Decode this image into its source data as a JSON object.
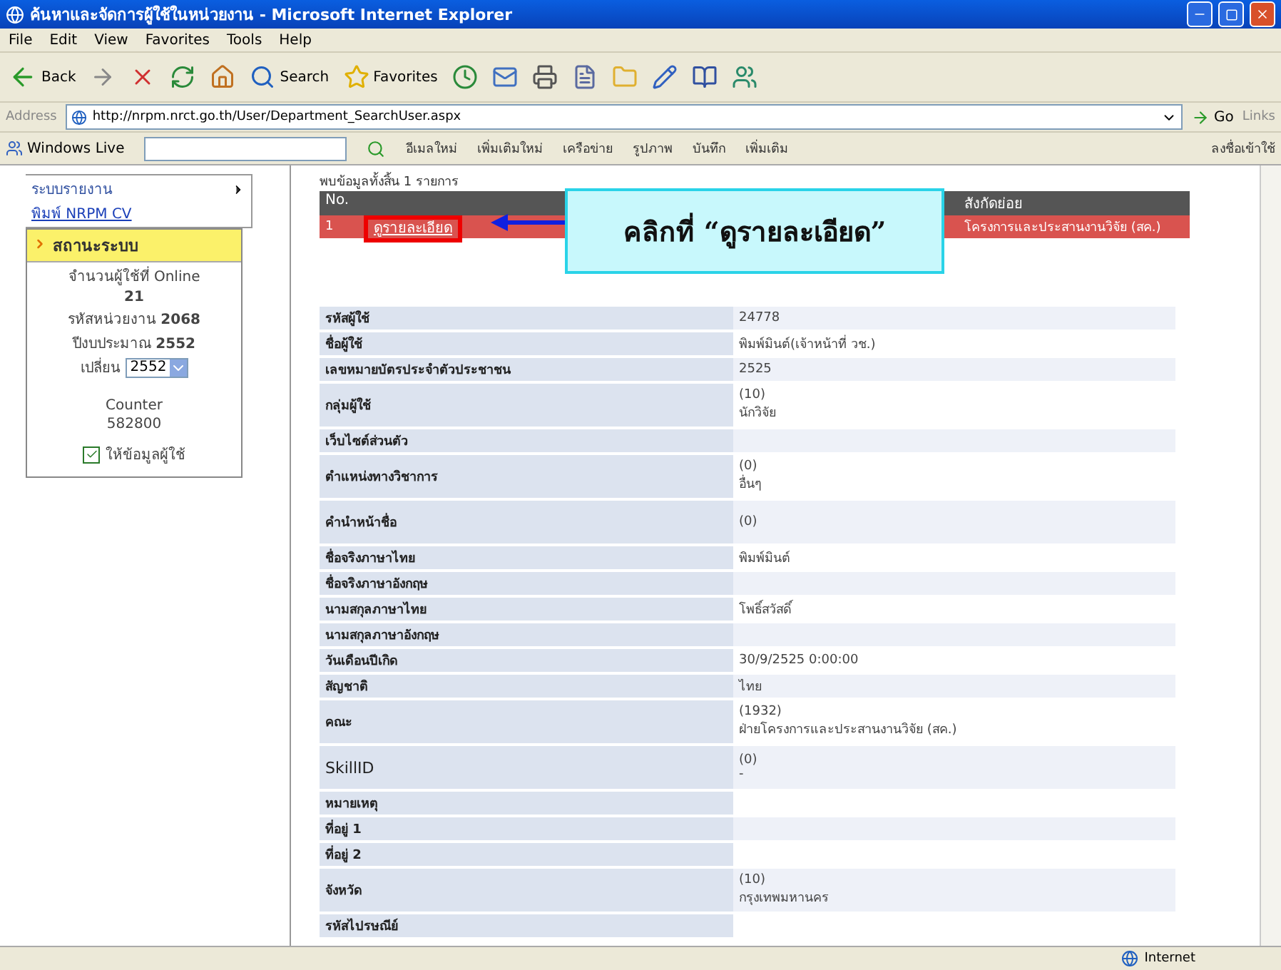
{
  "window": {
    "title": "ค้นหาและจัดการผู้ใช้ในหน่วยงาน - Microsoft Internet Explorer"
  },
  "menu": [
    "File",
    "Edit",
    "View",
    "Favorites",
    "Tools",
    "Help"
  ],
  "toolbar": [
    {
      "kind": "back",
      "label": "Back"
    },
    {
      "kind": "forward"
    },
    {
      "kind": "stop"
    },
    {
      "kind": "refresh"
    },
    {
      "kind": "home"
    },
    {
      "kind": "search",
      "label": "Search"
    },
    {
      "kind": "favorites",
      "label": "Favorites"
    },
    {
      "kind": "history"
    },
    {
      "kind": "mail"
    },
    {
      "kind": "print"
    },
    {
      "kind": "edit"
    },
    {
      "kind": "folder"
    },
    {
      "kind": "pen"
    },
    {
      "kind": "book"
    },
    {
      "kind": "people"
    }
  ],
  "address_bar": {
    "label": "Address",
    "value": "http://nrpm.nrct.go.th/User/Department_SearchUser.aspx",
    "go": "Go",
    "links": "Links"
  },
  "live_toolbar": {
    "brand": "Windows Live",
    "items": [
      "อีเมลใหม่",
      "เพิ่มเติมใหม่",
      "เครือข่าย",
      "รูปภาพ",
      "บันทึก",
      "เพิ่มเติม"
    ],
    "sign_in": "ลงชื่อเข้าใช้"
  },
  "sidebar": {
    "menu": [
      {
        "label": "ระบบรายงาน",
        "submenu": true,
        "link": false
      },
      {
        "label": "พิมพ์ NRPM CV",
        "submenu": false,
        "link": true
      }
    ],
    "status_panel": {
      "title": "สถานะระบบ",
      "lines": [
        "จำนวนผู้ใช้ที่ Online",
        "**21**",
        "รหัสหน่วยงาน **2068**",
        "ปีงบประมาณ **2552**"
      ],
      "year_label": "เปลี่ยน",
      "year": "2552",
      "counter_label": "Counter",
      "counter": "582800",
      "checkbox": {
        "label": "ให้ข้อมูลผู้ใช้",
        "checked": true
      }
    }
  },
  "results": {
    "summary": "พบข้อมูลทั้งสิ้น 1 รายการ",
    "header": {
      "no": "No.",
      "unit": "สังกัดย่อย"
    },
    "row": {
      "no": "1",
      "detail_link": "ดูรายละเอียด",
      "unit": "โครงการและประสานงานวิจัย (สค.)",
      "highlighted": true
    }
  },
  "callout": {
    "text": "คลิกที่ “ดูรายละเอียด”"
  },
  "details": [
    {
      "label": "รหัสผู้ใช้",
      "value": [
        "24778"
      ]
    },
    {
      "label": "ชื่อผู้ใช้",
      "value": [
        "พิมพ์มินต์(เจ้าหน้าที่ วช.)"
      ]
    },
    {
      "label": "เลขหมายบัตรประจำตัวประชาชน",
      "value": [
        "2525"
      ]
    },
    {
      "label": "กลุ่มผู้ใช้",
      "value": [
        "(10)",
        "นักวิจัย"
      ]
    },
    {
      "label": "เว็บไซต์ส่วนตัว"
    },
    {
      "label": "ตำแหน่งทางวิชาการ",
      "value": [
        "(0)",
        "อื่นๆ"
      ]
    },
    {
      "label": "คำนำหน้าชื่อ",
      "value": [
        "(0)"
      ],
      "tall": true
    },
    {
      "label": "ชื่อจริงภาษาไทย",
      "value": [
        "พิมพ์มินต์"
      ]
    },
    {
      "label": "ชื่อจริงภาษาอังกฤษ"
    },
    {
      "label": "นามสกุลภาษาไทย",
      "value": [
        "โพธิ์สวัสดิ์"
      ]
    },
    {
      "label": "นามสกุลภาษาอังกฤษ"
    },
    {
      "label": "วันเดือนปีเกิด",
      "value": [
        "30/9/2525 0:00:00"
      ]
    },
    {
      "label": "สัญชาติ",
      "value": [
        "ไทย"
      ]
    },
    {
      "label": "คณะ",
      "value": [
        "(1932)",
        "ฝ่ายโครงการและประสานงานวิจัย (สค.)"
      ]
    },
    {
      "label": "SkillID",
      "value": [
        "(0)",
        "-"
      ],
      "plain": true
    },
    {
      "label": "หมายเหตุ"
    },
    {
      "label": "ที่อยู่ 1"
    },
    {
      "label": "ที่อยู่ 2"
    },
    {
      "label": "จังหวัด",
      "value": [
        "(10)",
        "กรุงเทพมหานคร"
      ]
    },
    {
      "label": "รหัสไปรษณีย์"
    }
  ],
  "status_bar": {
    "zone": "Internet"
  }
}
